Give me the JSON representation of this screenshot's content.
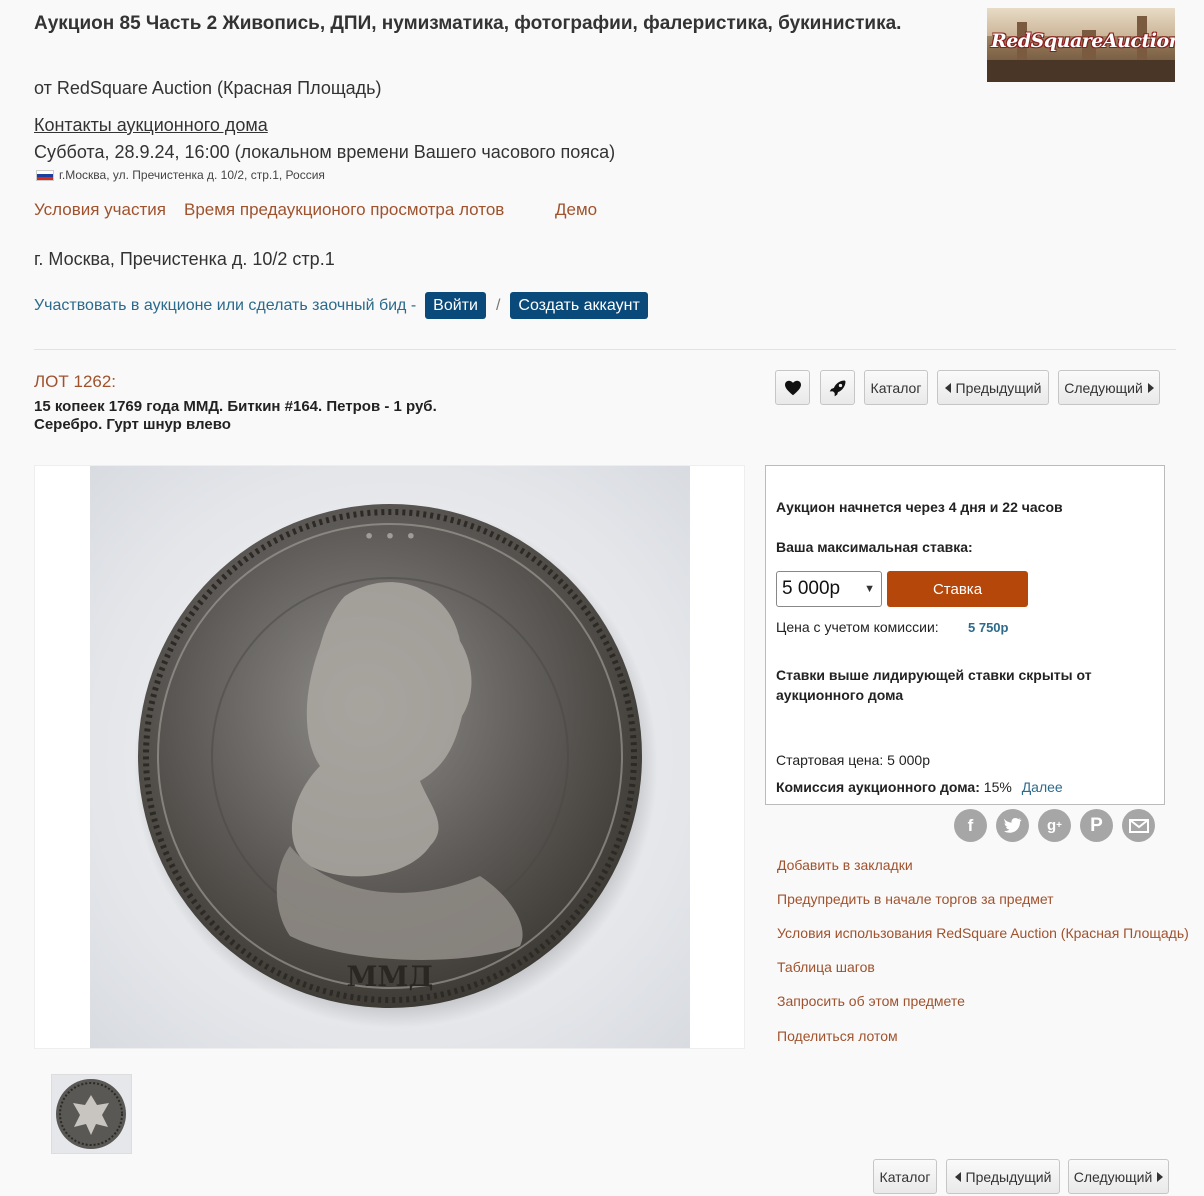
{
  "header": {
    "title": "Аукцион 85 Часть 2 Живопись, ДПИ, нумизматика, фотографии, фалеристика, букинистика.",
    "byline": "от RedSquare Auction (Красная Площадь)",
    "contacts_link": "Контакты аукционного дома",
    "datetime": "Суббота, 28.9.24, 16:00 (локальном времени Вашего часового пояса)",
    "address_small": "г.Москва, ул. Пречистенка д. 10/2, стр.1, Россия",
    "links": {
      "conditions": "Условия участия",
      "preview": "Время предаукционого просмотра лотов",
      "demo": "Демо"
    },
    "city_address": "г. Москва, Пречистенка д. 10/2 стр.1",
    "participate_text": "Участвовать в аукционе или сделать заочный бид -",
    "login_label": "Войти",
    "separator": "/",
    "create_account_label": "Создать аккаунт",
    "logo_text": "RedSquareAuction"
  },
  "lot": {
    "number": "ЛОТ 1262:",
    "description": "15 копеек 1769 года ММД. Биткин #164. Петров - 1 руб. Серебро. Гурт шнур влево"
  },
  "toolbar": {
    "catalog": "Каталог",
    "previous": "Предыдущий",
    "next": "Следующий"
  },
  "bid": {
    "auction_starts": "Аукцион начнется через 4 дня и 22 часов",
    "max_bid_label": "Ваша максимальная ставка:",
    "selected_bid": "5 000р",
    "bid_button": "Ставка",
    "price_with_commission_label": "Цена с учетом комиссии:",
    "price_with_commission_value": "5 750р",
    "hidden_bids_note": "Ставки выше лидирующей ставки скрыты от аукционного дома",
    "starting_price_label": "Стартовая цена:",
    "starting_price_value": "5 000р",
    "commission_label": "Комиссия аукционного дома:",
    "commission_value": "15%",
    "more_link": "Далее"
  },
  "social": [
    "facebook-icon",
    "twitter-icon",
    "google-plus-icon",
    "pinterest-icon",
    "email-icon"
  ],
  "side_links": {
    "bookmark": "Добавить в закладки",
    "notify": "Предупредить в начале торгов за предмет",
    "terms": "Условия использования RedSquare Auction (Красная Площадь)",
    "steps": "Таблица шагов",
    "ask": "Запросить об этом предмете",
    "share": "Поделиться лотом"
  },
  "bottom_nav": {
    "catalog": "Каталог",
    "previous": "Предыдущий",
    "next": "Следующий"
  },
  "colors": {
    "link_brown": "#a0522d",
    "button_blue": "#0a4a7a",
    "bid_orange": "#b5470b"
  }
}
